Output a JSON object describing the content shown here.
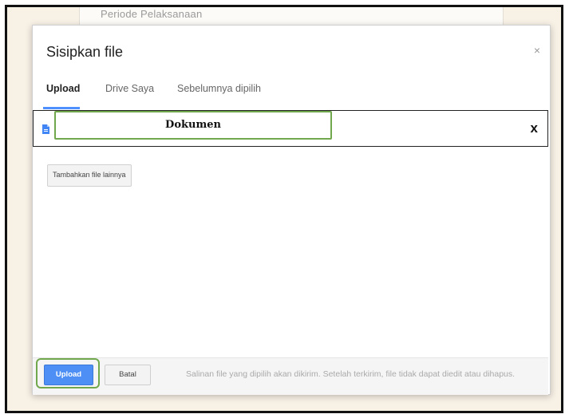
{
  "background": {
    "partial_text": "Periode Pelaksanaan"
  },
  "dialog": {
    "title": "Sisipkan file",
    "close_symbol": "×",
    "tabs": [
      {
        "label": "Upload",
        "active": true
      },
      {
        "label": "Drive Saya",
        "active": false
      },
      {
        "label": "Sebelumnya dipilih",
        "active": false
      }
    ],
    "file": {
      "icon": "doc-file-icon",
      "name": "Dokumen",
      "remove_symbol": "x"
    },
    "add_more_label": "Tambahkan file lainnya",
    "footer": {
      "upload_label": "Upload",
      "cancel_label": "Batal",
      "note": "Salinan file yang dipilih akan dikirim. Setelah terkirim, file tidak dapat diedit atau dihapus."
    }
  },
  "colors": {
    "accent_blue": "#4d8ff4",
    "highlight_green": "#71a84d",
    "doc_icon": "#4285f4"
  }
}
